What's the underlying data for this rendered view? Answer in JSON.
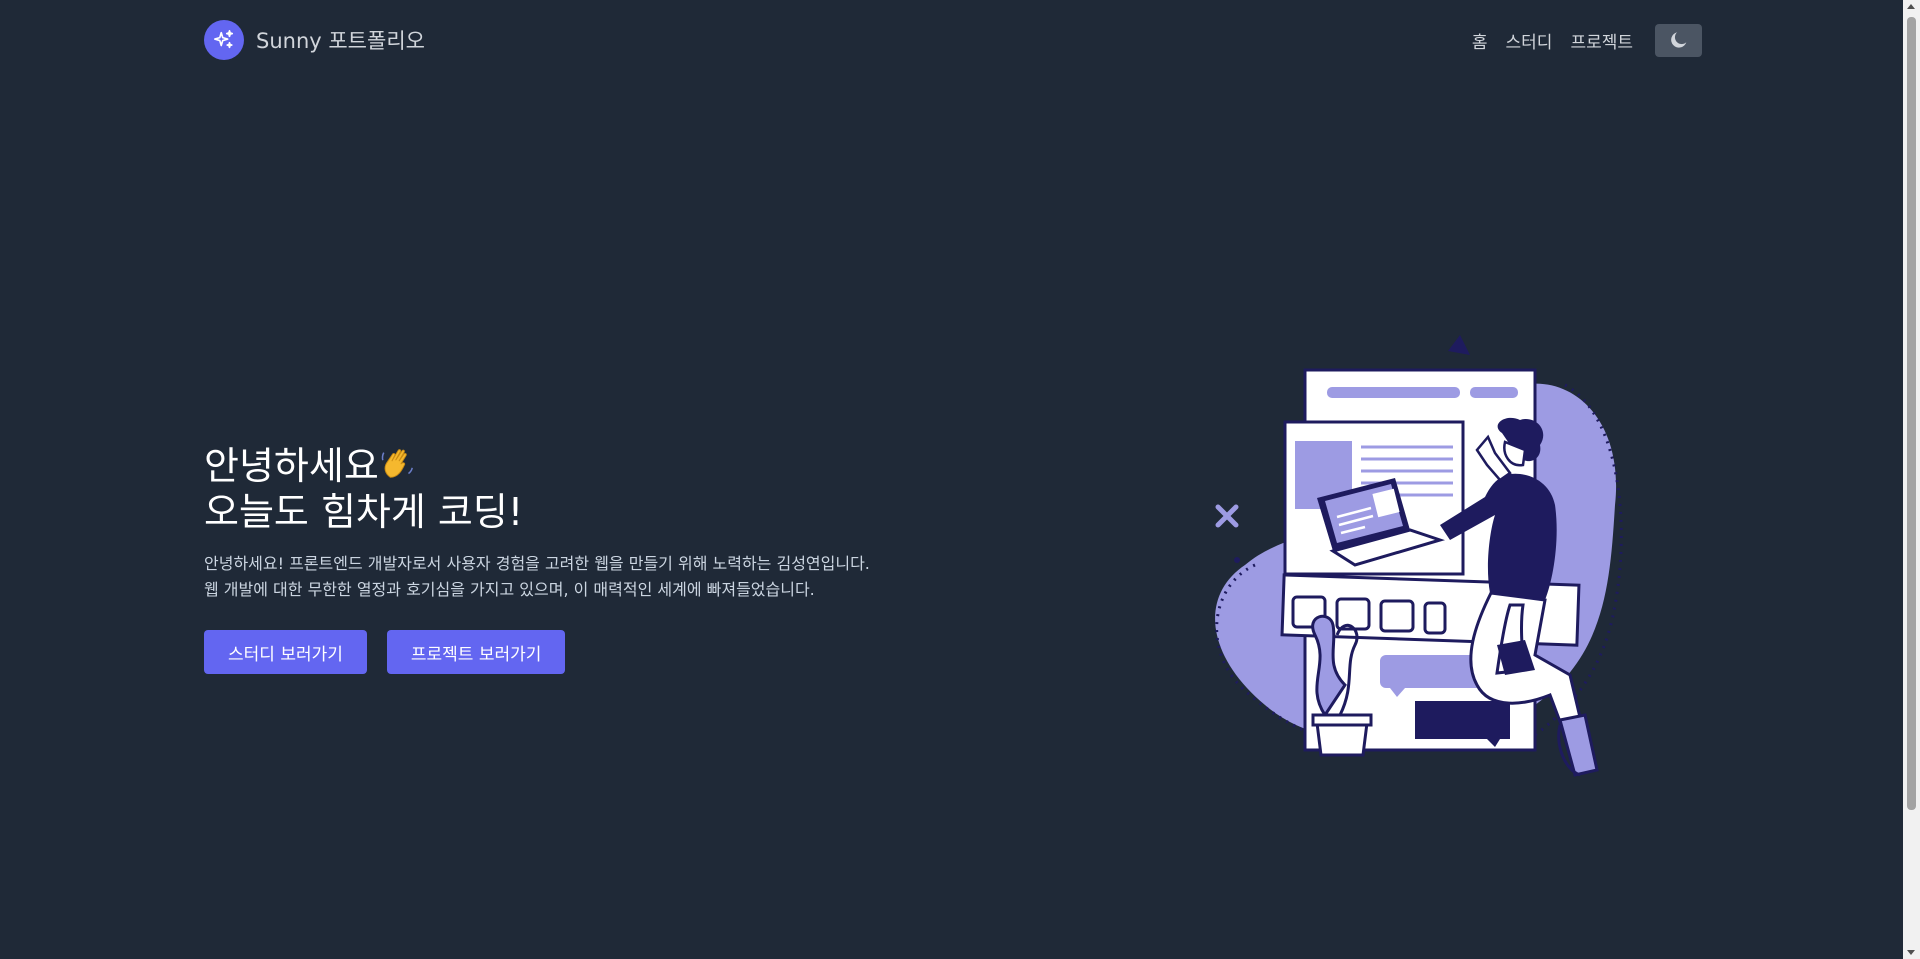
{
  "header": {
    "brand": "Sunny 포트폴리오",
    "logo_icon": "sparkles-icon",
    "nav": [
      {
        "label": "홈"
      },
      {
        "label": "스터디"
      },
      {
        "label": "프로젝트"
      }
    ],
    "theme_toggle_icon": "moon-icon"
  },
  "hero": {
    "title_line1": "안녕하세요",
    "title_emoji": "waving-hand-icon",
    "title_line2": "오늘도 힘차게 코딩!",
    "desc_line1": "안녕하세요! 프론트엔드 개발자로서 사용자 경험을 고려한 웹을 만들기 위해 노력하는 김성연입니다.",
    "desc_line2": "웹 개발에 대한 무한한 열정과 호기심을 가지고 있으며, 이 매력적인 세계에 빠져들었습니다.",
    "buttons": [
      {
        "label": "스터디 보러가기"
      },
      {
        "label": "프로젝트 보러가기"
      }
    ]
  },
  "colors": {
    "background": "#1f2937",
    "accent": "#6366f1",
    "illustration_primary": "#1e1b5e",
    "illustration_light": "#9d9be3"
  }
}
